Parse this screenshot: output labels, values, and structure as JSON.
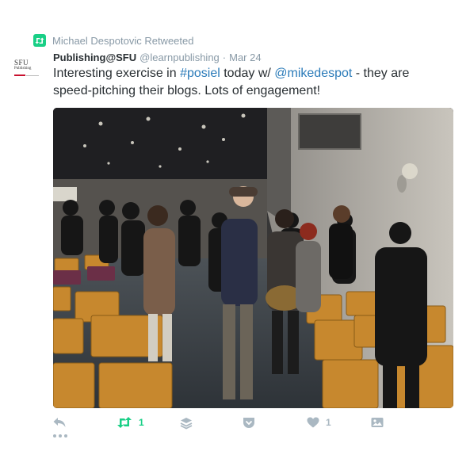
{
  "retweet_context": {
    "text": "Michael Despotovic Retweeted",
    "icon": "retweet-icon",
    "color": "#19cf86"
  },
  "tweet": {
    "avatar": {
      "line1": "SFU",
      "line2": "Publishing"
    },
    "author": "Publishing@SFU",
    "handle": "@learnpublishing",
    "separator": "·",
    "date": "Mar 24",
    "text": {
      "part1": "Interesting exercise in ",
      "hashtag": "#posiel",
      "part2": " today w/ ",
      "mention": "@mikedespot",
      "part3": " - they are speed-pitching their blogs. Lots of engagement!"
    },
    "link_color": "#2b7bb9",
    "media": {
      "icon": "photo"
    }
  },
  "actions": {
    "reply": {
      "icon": "reply-icon"
    },
    "retweet": {
      "icon": "retweet-icon",
      "count": "1"
    },
    "stack": {
      "icon": "layers-icon"
    },
    "pocket": {
      "icon": "pocket-icon"
    },
    "like": {
      "icon": "heart-icon",
      "count": "1"
    },
    "photo": {
      "icon": "image-icon"
    },
    "more": {
      "icon": "more-dots-icon"
    }
  }
}
